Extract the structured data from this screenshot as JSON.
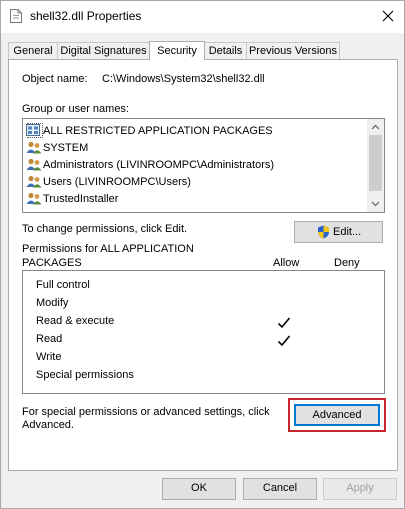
{
  "window": {
    "title": "shell32.dll Properties",
    "app_icon": "file-icon",
    "close_icon": "close-icon"
  },
  "tabs": [
    {
      "label": "General"
    },
    {
      "label": "Digital Signatures"
    },
    {
      "label": "Security",
      "active": true
    },
    {
      "label": "Details"
    },
    {
      "label": "Previous Versions"
    }
  ],
  "security": {
    "object_name_label": "Object name:",
    "object_name_value": "C:\\Windows\\System32\\shell32.dll",
    "group_label": "Group or user names:",
    "users": [
      {
        "label": "ALL RESTRICTED APPLICATION PACKAGES",
        "icon": "app-packages-icon"
      },
      {
        "label": "SYSTEM",
        "icon": "users-icon"
      },
      {
        "label": "Administrators (LIVINROOMPC\\Administrators)",
        "icon": "users-icon"
      },
      {
        "label": "Users (LIVINROOMPC\\Users)",
        "icon": "users-icon"
      },
      {
        "label": "TrustedInstaller",
        "icon": "users-icon"
      }
    ],
    "change_text": "To change permissions, click Edit.",
    "edit_label": "Edit...",
    "edit_icon": "uac-shield-icon",
    "permissions_header_line1": "Permissions for ALL APPLICATION",
    "permissions_header_line2": "PACKAGES",
    "allow_label": "Allow",
    "deny_label": "Deny",
    "permissions": [
      {
        "label": "Full control",
        "allow": false,
        "deny": false
      },
      {
        "label": "Modify",
        "allow": false,
        "deny": false
      },
      {
        "label": "Read & execute",
        "allow": true,
        "deny": false
      },
      {
        "label": "Read",
        "allow": true,
        "deny": false
      },
      {
        "label": "Write",
        "allow": false,
        "deny": false
      },
      {
        "label": "Special permissions",
        "allow": false,
        "deny": false
      }
    ],
    "advanced_text_line1": "For special permissions or advanced settings, click",
    "advanced_text_line2": "Advanced.",
    "advanced_label": "Advanced",
    "highlight_color": "#c9252d"
  },
  "footer": {
    "ok_label": "OK",
    "cancel_label": "Cancel",
    "apply_label": "Apply"
  }
}
